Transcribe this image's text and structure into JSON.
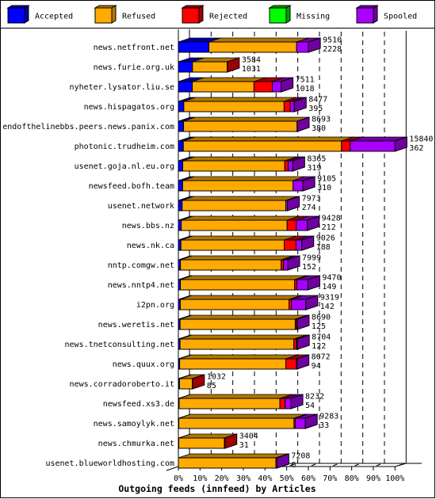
{
  "chart_data": {
    "type": "bar",
    "orientation": "horizontal",
    "stacked": true,
    "style": "3d",
    "title": "Outgoing feeds (innfeed) by Articles",
    "xlabel": "",
    "ylabel": "",
    "xlim": [
      0,
      100
    ],
    "x_unit": "percent of largest offered total",
    "x_tick_labels": [
      "0%",
      "10%",
      "20%",
      "30%",
      "40%",
      "50%",
      "60%",
      "70%",
      "80%",
      "90%",
      "100%"
    ],
    "grid": true,
    "legend_position": "top",
    "categories": [
      "news.netfront.net",
      "news.furie.org.uk",
      "nyheter.lysator.liu.se",
      "news.hispagatos.org",
      "endofthelinebbs.peers.news.panix.com",
      "photonic.trudheim.com",
      "usenet.goja.nl.eu.org",
      "newsfeed.bofh.team",
      "usenet.network",
      "news.bbs.nz",
      "news.nk.ca",
      "nntp.comgw.net",
      "news.nntp4.net",
      "i2pn.org",
      "news.weretis.net",
      "news.tnetconsulting.net",
      "news.quux.org",
      "news.corradoroberto.it",
      "newsfeed.xs3.de",
      "news.samoylyk.net",
      "news.chmurka.net",
      "usenet.blueworldhosting.com"
    ],
    "series": [
      {
        "name": "Accepted",
        "color": "#0000ff",
        "dark": "#0000a0",
        "values": [
          2228,
          1031,
          1018,
          395,
          380,
          362,
          319,
          310,
          274,
          212,
          188,
          152,
          149,
          142,
          125,
          122,
          94,
          85,
          54,
          33,
          31,
          0
        ]
      },
      {
        "name": "Refused",
        "color": "#ffaa00",
        "dark": "#b07800",
        "values": [
          6415,
          2543,
          4510,
          7335,
          8300,
          11565,
          7460,
          8075,
          7579,
          7740,
          7550,
          7366,
          8355,
          7944,
          8421,
          8323,
          7763,
          930,
          7369,
          8422,
          3333,
          7129
        ]
      },
      {
        "name": "Rejected",
        "color": "#ff0000",
        "dark": "#a00000",
        "values": [
          0,
          10,
          1340,
          460,
          0,
          636,
          255,
          0,
          0,
          670,
          865,
          173,
          156,
          173,
          96,
          193,
          771,
          17,
          385,
          96,
          40,
          0
        ]
      },
      {
        "name": "Missing",
        "color": "#00ff00",
        "dark": "#00a000",
        "values": [
          0,
          0,
          0,
          0,
          0,
          0,
          0,
          0,
          0,
          0,
          0,
          0,
          0,
          0,
          0,
          0,
          0,
          0,
          0,
          0,
          0,
          0
        ]
      },
      {
        "name": "Spooled",
        "color": "#aa00ff",
        "dark": "#7000a0",
        "values": [
          867,
          0,
          643,
          287,
          13,
          3277,
          331,
          720,
          120,
          806,
          423,
          308,
          810,
          1060,
          48,
          66,
          44,
          0,
          424,
          732,
          0,
          79
        ]
      }
    ],
    "bar_labels": {
      "offered": [
        9510,
        3584,
        7511,
        8477,
        8693,
        15840,
        8365,
        9105,
        7973,
        9428,
        9026,
        7999,
        9470,
        9319,
        8690,
        8704,
        8672,
        1032,
        8232,
        9283,
        3404,
        7208
      ],
      "accepted": [
        2228,
        1031,
        1018,
        395,
        380,
        362,
        319,
        310,
        274,
        212,
        188,
        152,
        149,
        142,
        125,
        122,
        94,
        85,
        54,
        33,
        31,
        0
      ]
    }
  }
}
